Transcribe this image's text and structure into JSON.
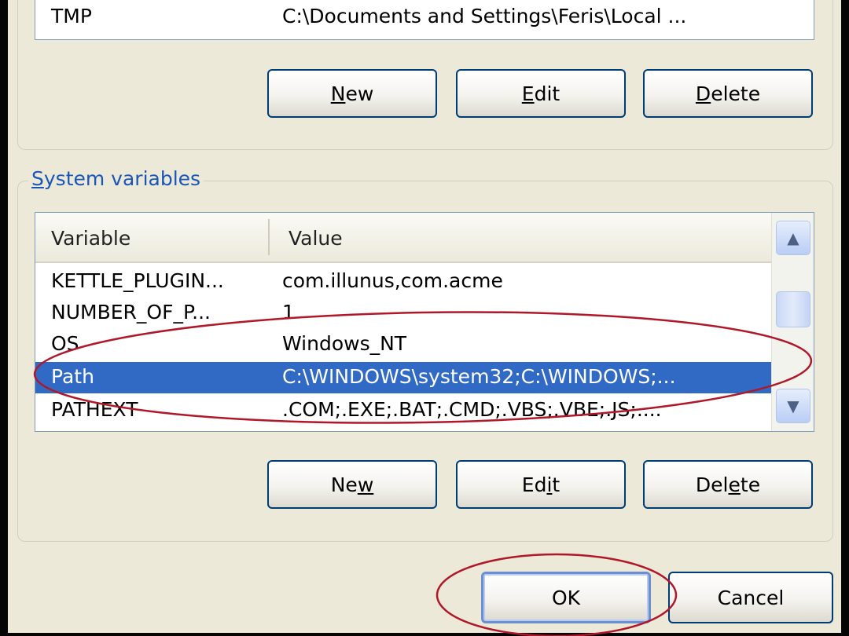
{
  "user_variables": {
    "visible_row": {
      "variable": "TMP",
      "value": "C:\\Documents and Settings\\Feris\\Local ..."
    },
    "buttons": {
      "new": {
        "pre": "",
        "key": "N",
        "post": "ew"
      },
      "edit": {
        "pre": "",
        "key": "E",
        "post": "dit"
      },
      "delete": {
        "pre": "",
        "key": "D",
        "post": "elete"
      }
    }
  },
  "system_variables": {
    "legend": {
      "key": "S",
      "rest": "ystem variables"
    },
    "columns": {
      "variable": "Variable",
      "value": "Value"
    },
    "rows": [
      {
        "variable": "KETTLE_PLUGIN...",
        "value": "com.illunus,com.acme"
      },
      {
        "variable": "NUMBER_OF_P...",
        "value": "1"
      },
      {
        "variable": "OS",
        "value": "Windows_NT"
      },
      {
        "variable": "Path",
        "value": "C:\\WINDOWS\\system32;C:\\WINDOWS;..."
      },
      {
        "variable": "PATHEXT",
        "value": ".COM;.EXE;.BAT;.CMD;.VBS;.VBE;.JS;...."
      }
    ],
    "selected_row": "Path",
    "buttons": {
      "new": {
        "pre": "Ne",
        "key": "w",
        "post": ""
      },
      "edit": {
        "pre": "Ed",
        "key": "i",
        "post": "t"
      },
      "delete": {
        "pre": "Del",
        "key": "e",
        "post": "te"
      }
    }
  },
  "dialog_buttons": {
    "ok": "OK",
    "cancel": "Cancel"
  },
  "scrollbar": {
    "up_icon": "chevron-up-icon",
    "down_icon": "chevron-down-icon"
  },
  "annotations": {
    "highlight_color": "#b0182a",
    "circled": [
      "Path row",
      "OK button"
    ]
  },
  "colors": {
    "window_bg": "#ece9d8",
    "selection": "#316ac5",
    "legend_text": "#1a56b8"
  }
}
